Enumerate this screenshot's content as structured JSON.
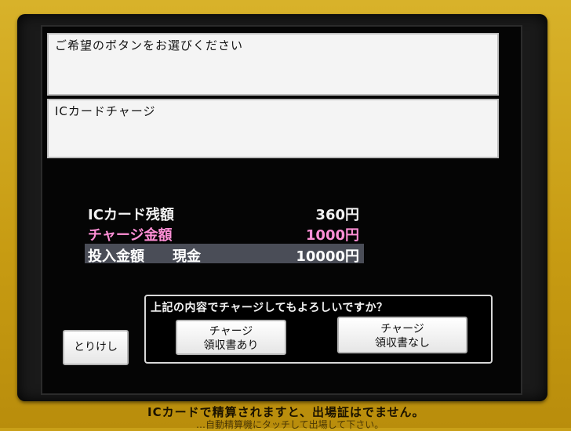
{
  "screen": {
    "instruction": "ご希望のボタンをお選びください",
    "mode_title": "ICカードチャージ"
  },
  "summary": {
    "balance_label": "ICカード残額",
    "balance_value": "360円",
    "charge_label": "チャージ金額",
    "charge_value": "1000円",
    "inserted_label": "投入金額",
    "inserted_method": "現金",
    "inserted_value": "10000円"
  },
  "confirm": {
    "question": "上記の内容でチャージしてもよろしいですか？",
    "with_receipt_line1": "チャージ",
    "with_receipt_line2": "領収書あり",
    "no_receipt_line1": "チャージ",
    "no_receipt_line2": "領収書なし"
  },
  "cancel_label": "とりけし",
  "machine_sticker": {
    "line1": "ICカードで精算されますと、出場証はでません。",
    "line2": "…自動精算機にタッチして出場して下さい。"
  },
  "colors": {
    "machine_yellow": "#c9a018",
    "charge_pink": "#ff8fd6",
    "highlight_row": "#4a4d57"
  }
}
